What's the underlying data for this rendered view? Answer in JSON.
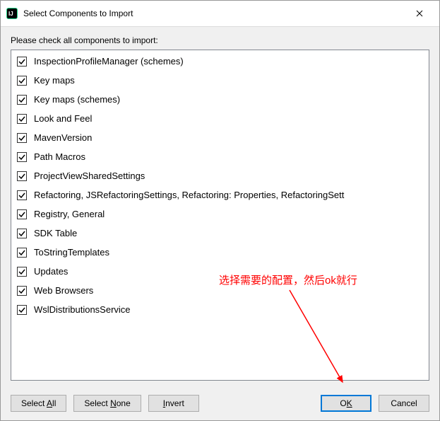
{
  "titlebar": {
    "title": "Select Components to Import"
  },
  "instruction": "Please check all components to import:",
  "items": [
    {
      "label": "InspectionProfileManager (schemes)",
      "checked": true
    },
    {
      "label": "Key maps",
      "checked": true
    },
    {
      "label": "Key maps (schemes)",
      "checked": true
    },
    {
      "label": "Look and Feel",
      "checked": true
    },
    {
      "label": "MavenVersion",
      "checked": true
    },
    {
      "label": "Path Macros",
      "checked": true
    },
    {
      "label": "ProjectViewSharedSettings",
      "checked": true
    },
    {
      "label": "Refactoring, JSRefactoringSettings, Refactoring: Properties, RefactoringSett",
      "checked": true
    },
    {
      "label": "Registry, General",
      "checked": true
    },
    {
      "label": "SDK Table",
      "checked": true
    },
    {
      "label": "ToStringTemplates",
      "checked": true
    },
    {
      "label": "Updates",
      "checked": true
    },
    {
      "label": "Web Browsers",
      "checked": true
    },
    {
      "label": "WslDistributionsService",
      "checked": true
    }
  ],
  "buttons": {
    "select_all_pre": "Select ",
    "select_all_u": "A",
    "select_all_post": "ll",
    "select_none_pre": "Select ",
    "select_none_u": "N",
    "select_none_post": "one",
    "invert_u": "I",
    "invert_post": "nvert",
    "ok_pre": "O",
    "ok_u": "K",
    "cancel": "Cancel"
  },
  "annotation_text": "选择需要的配置，然后ok就行"
}
